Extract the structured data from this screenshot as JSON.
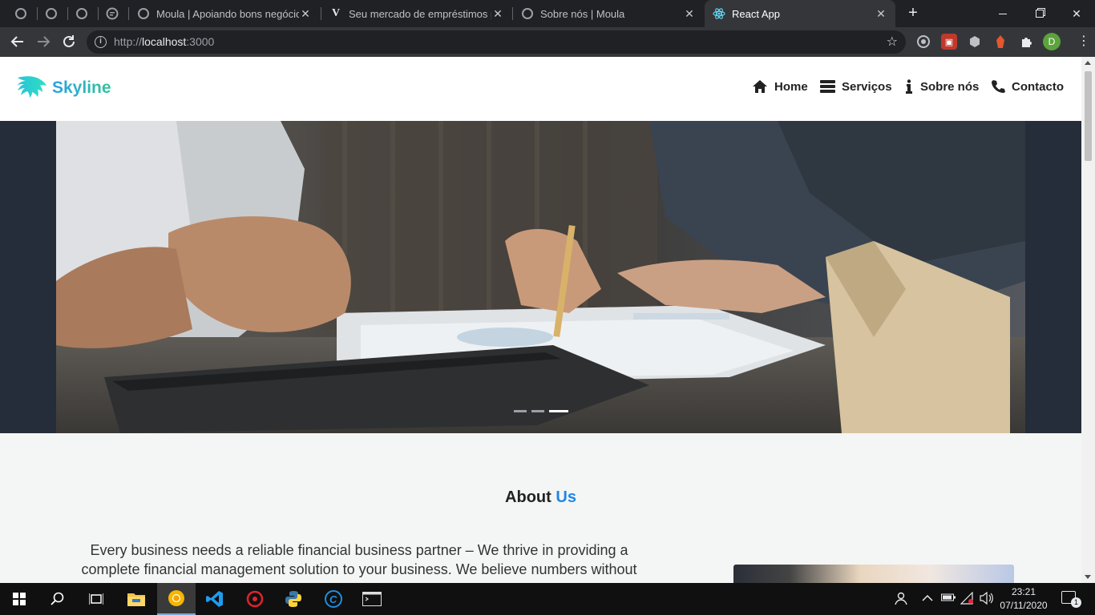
{
  "browser": {
    "tabs": [
      {
        "title": "Moula | Apoiando bons negócios",
        "favicon": "globe-icon"
      },
      {
        "title": "Seu mercado de empréstimos pa",
        "favicon": "v-logo-icon"
      },
      {
        "title": "Sobre nós | Moula",
        "favicon": "globe-icon"
      },
      {
        "title": "React App",
        "favicon": "react-icon",
        "active": true
      }
    ],
    "close_glyph": "✕",
    "new_tab_glyph": "+",
    "url_protocol": "http://",
    "url_host": "localhost",
    "url_port": ":3000",
    "profile_initial": "D"
  },
  "site": {
    "logo_text": "Skyline",
    "nav": [
      {
        "label": "Home",
        "icon": "home-icon"
      },
      {
        "label": "Serviços",
        "icon": "server-icon"
      },
      {
        "label": "Sobre nós",
        "icon": "info-icon"
      },
      {
        "label": "Contacto",
        "icon": "phone-icon"
      }
    ],
    "carousel": {
      "slide_count": 3,
      "active_index": 2
    },
    "about": {
      "title_main": "About",
      "title_accent": "Us",
      "body": "Every business needs a reliable financial business partner – We thrive in providing a complete financial management solution to your business. We believe numbers without"
    }
  },
  "colors": {
    "accent": "#1e88e5",
    "logo_gradient_start": "#2aa1e3",
    "logo_gradient_end": "#33c49a",
    "hero_bg": "#252c3a"
  },
  "taskbar": {
    "time": "23:21",
    "date": "07/11/2020",
    "notification_count": "1",
    "apps": [
      "start-icon",
      "search-icon",
      "task-view-icon",
      "file-explorer-icon",
      "chrome-icon",
      "vscode-icon",
      "opera-icon",
      "python-icon",
      "ccleaner-icon",
      "terminal-icon"
    ]
  }
}
